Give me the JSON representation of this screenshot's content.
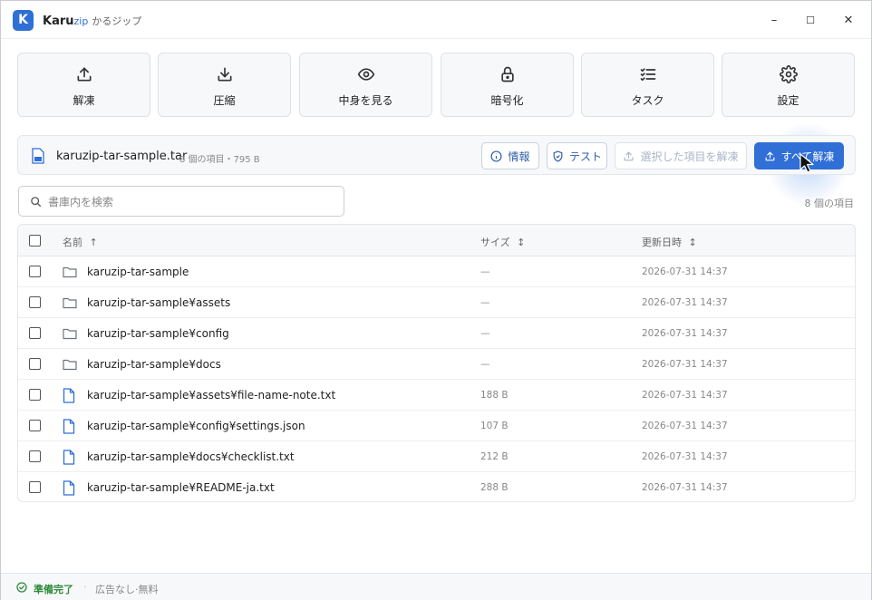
{
  "app": {
    "logo_letter": "K",
    "name_main": "Karu",
    "name_zip": "zip",
    "name_jp": "かるジップ"
  },
  "window_controls": {
    "minimize": "–",
    "maximize": "☐",
    "close": "✕"
  },
  "toolbar": {
    "items": [
      {
        "label": "解凍",
        "icon": "upload-icon"
      },
      {
        "label": "圧縮",
        "icon": "download-icon"
      },
      {
        "label": "中身を見る",
        "icon": "eye-icon"
      },
      {
        "label": "暗号化",
        "icon": "lock-icon"
      },
      {
        "label": "タスク",
        "icon": "list-check-icon"
      },
      {
        "label": "設定",
        "icon": "gear-icon"
      }
    ]
  },
  "archive": {
    "name": "karuzip-tar-sample.tar",
    "meta": "8 個の項目・795 B",
    "buttons": {
      "info": "情報",
      "test": "テスト",
      "extract_selected": "選択した項目を解凍",
      "extract_all": "すべて解凍"
    }
  },
  "search": {
    "placeholder": "書庫内を検索",
    "value": ""
  },
  "item_count": "8 個の項目",
  "table": {
    "columns": {
      "name": "名前",
      "size": "サイズ",
      "modified": "更新日時"
    },
    "sort_asc": "↑",
    "sort_both": "↕",
    "rows": [
      {
        "name": "karuzip-tar-sample",
        "type": "folder",
        "size": "—",
        "modified": "2026-07-31 14:37"
      },
      {
        "name": "karuzip-tar-sample¥assets",
        "type": "folder",
        "size": "—",
        "modified": "2026-07-31 14:37"
      },
      {
        "name": "karuzip-tar-sample¥config",
        "type": "folder",
        "size": "—",
        "modified": "2026-07-31 14:37"
      },
      {
        "name": "karuzip-tar-sample¥docs",
        "type": "folder",
        "size": "—",
        "modified": "2026-07-31 14:37"
      },
      {
        "name": "karuzip-tar-sample¥assets¥file-name-note.txt",
        "type": "file",
        "size": "188 B",
        "modified": "2026-07-31 14:37"
      },
      {
        "name": "karuzip-tar-sample¥config¥settings.json",
        "type": "file",
        "size": "107 B",
        "modified": "2026-07-31 14:37"
      },
      {
        "name": "karuzip-tar-sample¥docs¥checklist.txt",
        "type": "file",
        "size": "212 B",
        "modified": "2026-07-31 14:37"
      },
      {
        "name": "karuzip-tar-sample¥README-ja.txt",
        "type": "file",
        "size": "288 B",
        "modified": "2026-07-31 14:37"
      }
    ]
  },
  "status": {
    "ready": "準備完了",
    "separator": "·",
    "note": "広告なし·無料"
  },
  "colors": {
    "accent": "#2f6fd6",
    "success": "#2e8b3a"
  }
}
